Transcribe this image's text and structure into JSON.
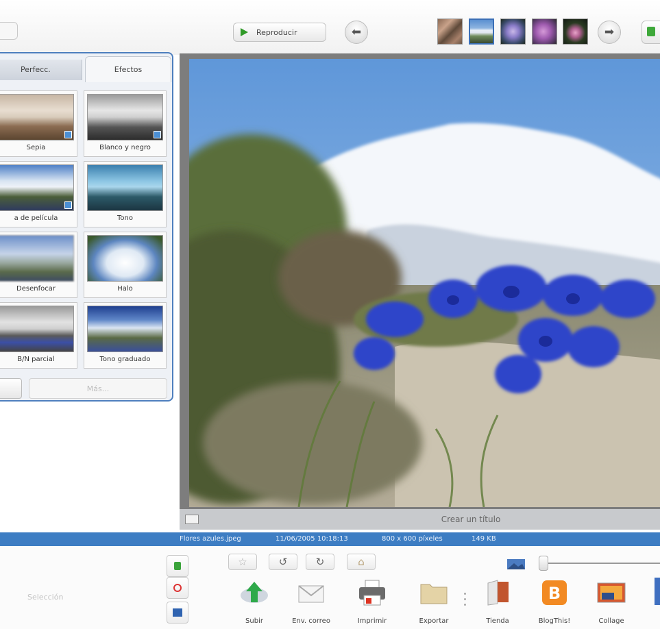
{
  "toolbar": {
    "play_label": "Reproducir",
    "prev_icon": "arrow-left-icon",
    "next_icon": "arrow-right-icon",
    "thumbnails": [
      {
        "name": "thumb-flowers-red"
      },
      {
        "name": "thumb-mountain"
      },
      {
        "name": "thumb-flower-purple"
      },
      {
        "name": "thumb-flower-violet"
      },
      {
        "name": "thumb-flower-pink"
      }
    ]
  },
  "panel": {
    "tabs": [
      {
        "label": "Perfecc."
      },
      {
        "label": "Efectos"
      }
    ],
    "effects": [
      {
        "label": "Sepia"
      },
      {
        "label": "Blanco y negro"
      },
      {
        "label": "a de película"
      },
      {
        "label": "Tono"
      },
      {
        "label": "Desenfocar"
      },
      {
        "label": "Halo"
      },
      {
        "label": "B/N parcial"
      },
      {
        "label": "Tono graduado"
      }
    ],
    "button_label": "Más..."
  },
  "viewer": {
    "caption_placeholder": "Crear un título"
  },
  "status": {
    "filename": "Flores azules.jpeg",
    "datetime": "11/06/2005 10:18:13",
    "dimensions": "800 x 600 píxeles",
    "filesize": "149 KB"
  },
  "bottom": {
    "selection_label": "Selección",
    "tools": [
      {
        "label": "Subir"
      },
      {
        "label": "Env. correo"
      },
      {
        "label": "Imprimir"
      },
      {
        "label": "Exportar"
      },
      {
        "label": "Tienda"
      },
      {
        "label": "BlogThis!"
      },
      {
        "label": "Collage"
      }
    ]
  }
}
